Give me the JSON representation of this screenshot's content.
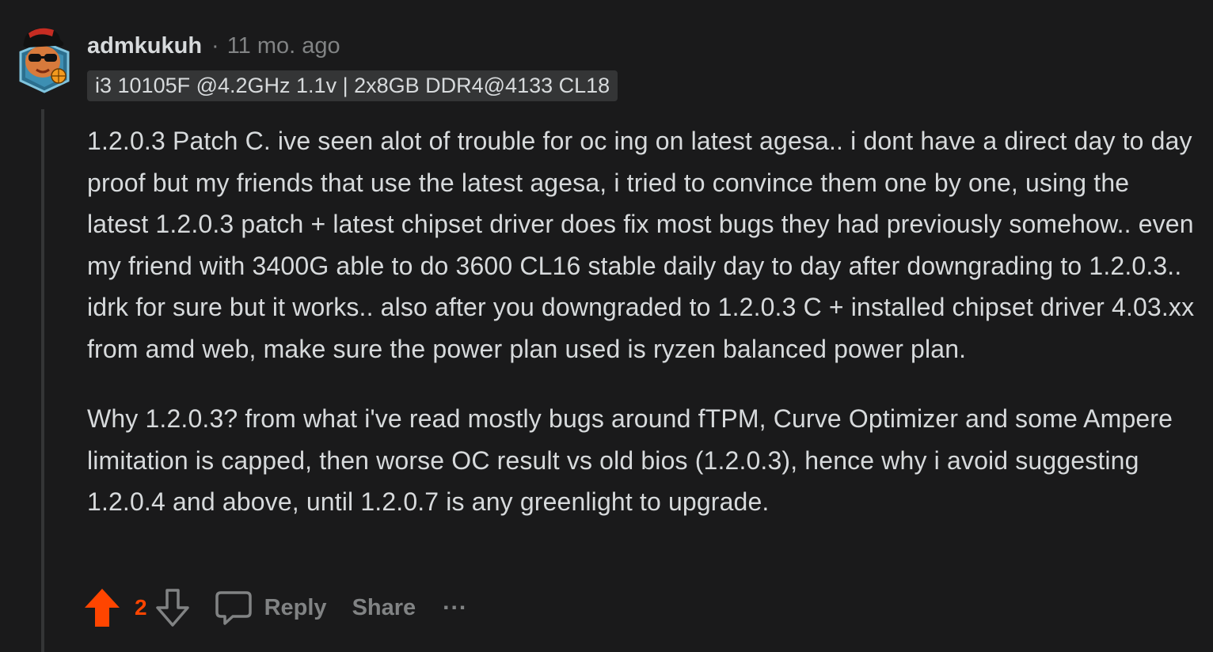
{
  "comment": {
    "username": "admkukuh",
    "separator": "·",
    "timestamp": "11 mo. ago",
    "flair": "i3 10105F @4.2GHz 1.1v | 2x8GB DDR4@4133 CL18",
    "paragraphs": [
      "1.2.0.3 Patch C. ive seen alot of trouble for oc ing on latest agesa.. i dont have a direct day to day proof but my friends that use the latest agesa, i tried to convince them one by one, using the latest 1.2.0.3 patch + latest chipset driver does fix most bugs they had previously somehow.. even my friend with 3400G able to do 3600 CL16 stable daily day to day after downgrading to 1.2.0.3.. idrk for sure but it works.. also after you downgraded to 1.2.0.3 C + installed chipset driver 4.03.xx from amd web, make sure the power plan used is ryzen balanced power plan.",
      "Why 1.2.0.3? from what i've read mostly bugs around fTPM, Curve Optimizer and some Ampere limitation is capped, then worse OC result vs old bios (1.2.0.3), hence why i avoid suggesting 1.2.0.4 and above, until 1.2.0.7 is any greenlight to upgrade."
    ]
  },
  "actions": {
    "upvote_icon": "arrow-up-filled-icon",
    "vote_count": "2",
    "downvote_icon": "arrow-down-outline-icon",
    "reply_icon": "speech-bubble-icon",
    "reply_label": "Reply",
    "share_label": "Share",
    "more_label": "..."
  },
  "colors": {
    "background": "#1a1a1b",
    "text": "#d7dadc",
    "muted": "#818384",
    "upvote": "#ff4500",
    "flair_bg": "#343536",
    "thread_line": "#343536"
  }
}
